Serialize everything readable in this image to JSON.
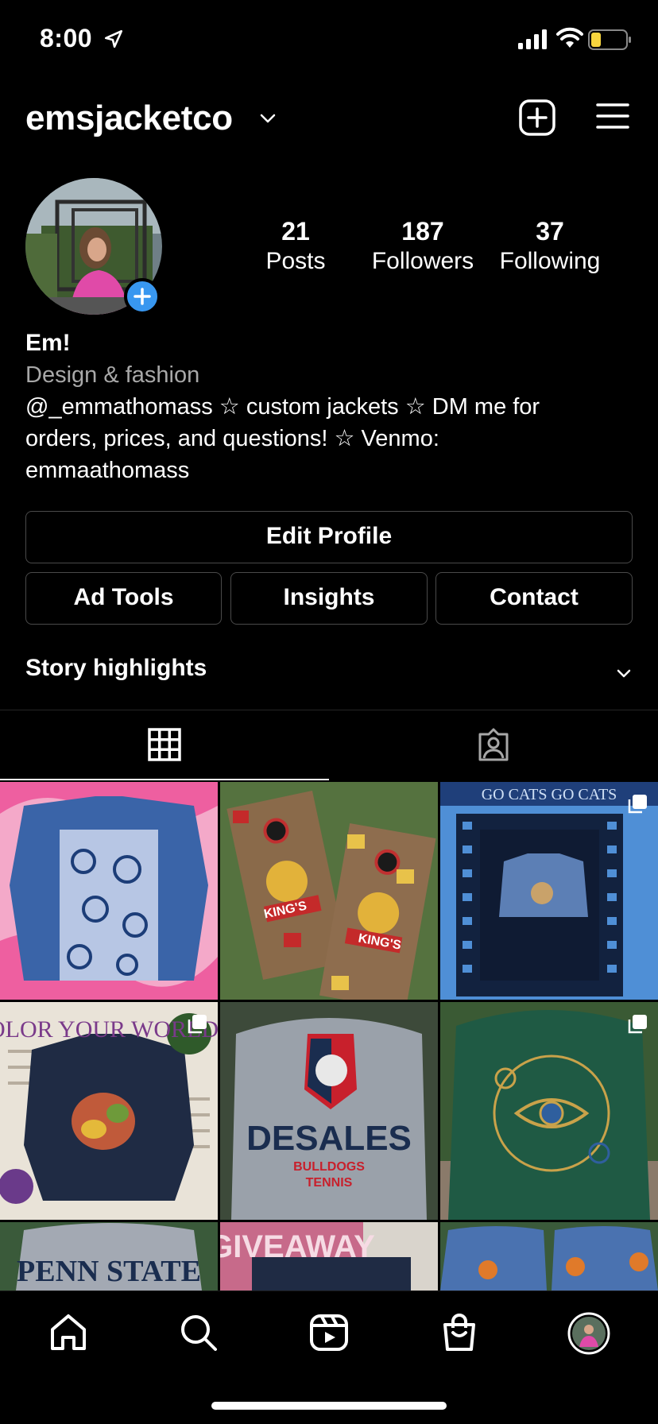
{
  "status": {
    "time": "8:00"
  },
  "header": {
    "username": "emsjacketco"
  },
  "stats": [
    {
      "value": "21",
      "label": "Posts"
    },
    {
      "value": "187",
      "label": "Followers"
    },
    {
      "value": "37",
      "label": "Following"
    }
  ],
  "bio": {
    "name": "Em!",
    "category": "Design & fashion",
    "line1": "@_emmathomass ☆ custom jackets ☆ DM me for",
    "line2": "orders, prices, and questions! ☆ Venmo:",
    "line3": "emmaathomass"
  },
  "buttons": {
    "edit_profile": "Edit Profile",
    "ad_tools": "Ad Tools",
    "insights": "Insights",
    "contact": "Contact"
  },
  "highlights": {
    "label": "Story highlights"
  },
  "grid": {
    "texts": {
      "go_cats": "GO CATS GO CATS",
      "kings": "KING'S",
      "color_your_world": "COLOR YOUR WORLD",
      "desales": "DESALES",
      "bulldogs": "BULLDOGS",
      "tennis": "TENNIS",
      "penn_state": "PENN STATE",
      "giveaway": "GIVEAWAY"
    }
  },
  "colors": {
    "accent": "#3897f0",
    "background": "#000000",
    "border": "#4a4a4a",
    "secondary_text": "#a8a8a8"
  }
}
